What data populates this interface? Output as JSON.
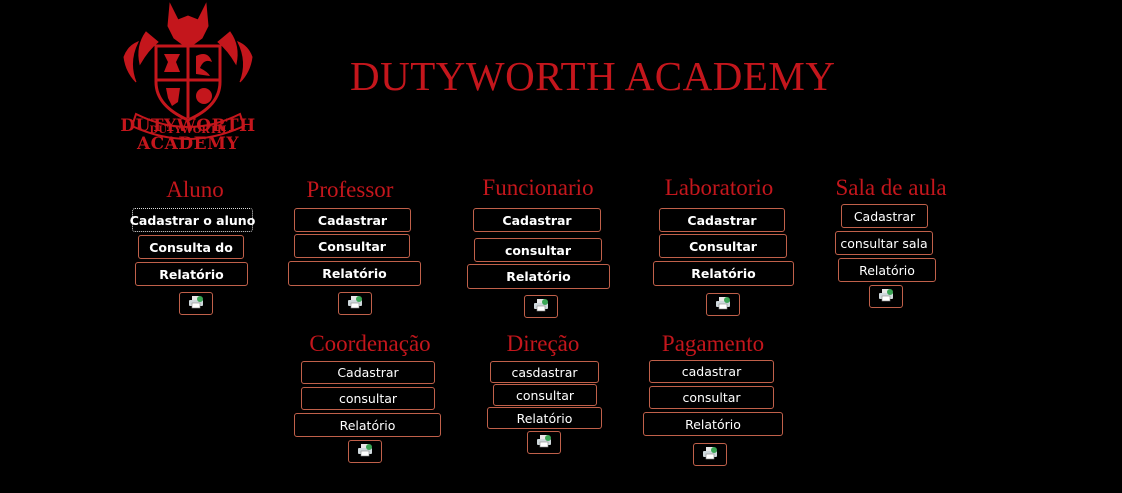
{
  "header": {
    "title": "DUTYWORTH ACADEMY",
    "logo_line1": "DUTYWORTH",
    "logo_line2": "ACADEMY",
    "logo_banner": "DUTYWORTH"
  },
  "colors": {
    "accent": "#c4161c",
    "border": "#c0604a",
    "background": "#000000"
  },
  "sections": {
    "aluno": {
      "title": "Aluno",
      "b1": "Cadastrar o aluno",
      "b2": "Consulta do",
      "b3": "Relatório",
      "print_icon": "printer-icon"
    },
    "professor": {
      "title": "Professor",
      "b1": "Cadastrar",
      "b2": "Consultar",
      "b3": "Relatório",
      "print_icon": "printer-icon"
    },
    "funcionario": {
      "title": "Funcionario",
      "b1": "Cadastrar",
      "b2": "consultar",
      "b3": "Relatório",
      "print_icon": "printer-icon"
    },
    "laboratorio": {
      "title": "Laboratorio",
      "b1": "Cadastrar",
      "b2": "Consultar",
      "b3": "Relatório",
      "print_icon": "printer-icon"
    },
    "sala": {
      "title": "Sala de aula",
      "b1": "Cadastrar",
      "b2": "consultar sala",
      "b3": "Relatório",
      "print_icon": "printer-icon"
    },
    "coordenacao": {
      "title": "Coordenação",
      "b1": "Cadastrar",
      "b2": "consultar",
      "b3": "Relatório",
      "print_icon": "printer-icon"
    },
    "direcao": {
      "title": "Direção",
      "b1": "casdastrar",
      "b2": "consultar",
      "b3": "Relatório",
      "print_icon": "printer-icon"
    },
    "pagamento": {
      "title": "Pagamento",
      "b1": "cadastrar",
      "b2": "consultar",
      "b3": "Relatório",
      "print_icon": "printer-icon"
    }
  }
}
